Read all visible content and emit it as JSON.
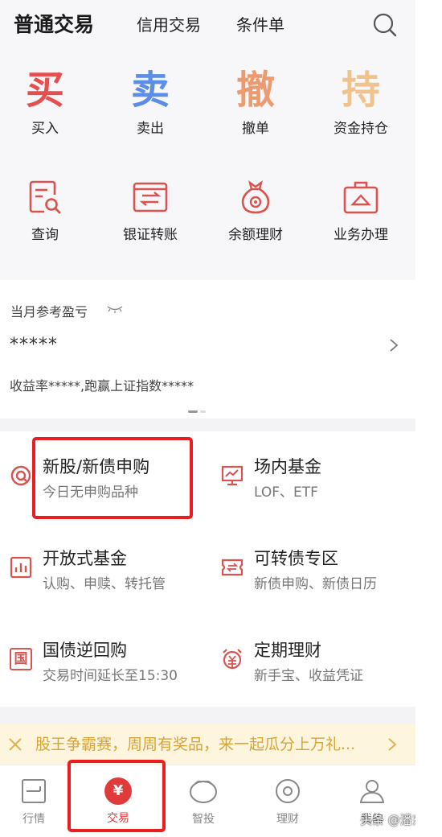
{
  "header": {
    "tabs": [
      "普通交易",
      "信用交易",
      "条件单"
    ]
  },
  "quick_actions": [
    {
      "glyph": "买",
      "label": "买入",
      "color": "#e5504f"
    },
    {
      "glyph": "卖",
      "label": "卖出",
      "color": "#5b8ee6"
    },
    {
      "glyph": "撤",
      "label": "撤单",
      "color": "#ec9b70"
    },
    {
      "glyph": "持",
      "label": "资金持仓",
      "color": "#f0c38c"
    }
  ],
  "tools": [
    {
      "icon": "query-icon",
      "label": "查询"
    },
    {
      "icon": "transfer-icon",
      "label": "银证转账"
    },
    {
      "icon": "money-bag-icon",
      "label": "余额理财"
    },
    {
      "icon": "briefcase-icon",
      "label": "业务办理"
    }
  ],
  "profit": {
    "title": "当月参考盈亏",
    "value": "*****",
    "rate": "收益率*****,跑赢上证指数*****"
  },
  "services": [
    {
      "icon": "ipo-icon",
      "title": "新股/新债申购",
      "sub": "今日无申购品种"
    },
    {
      "icon": "exchange-fund-icon",
      "title": "场内基金",
      "sub": "LOF、ETF"
    },
    {
      "icon": "open-fund-icon",
      "title": "开放式基金",
      "sub": "认购、申赎、转托管"
    },
    {
      "icon": "convertible-bond-icon",
      "title": "可转债专区",
      "sub": "新债申购、新债日历"
    },
    {
      "icon": "treasury-repo-icon",
      "glyph": "国",
      "title": "国债逆回购",
      "sub": "交易时间延长至15:30"
    },
    {
      "icon": "fixed-term-icon",
      "glyph": "¥",
      "title": "定期理财",
      "sub": "新手宝、收益凭证"
    }
  ],
  "banner": {
    "text": "股王争霸赛，周周有奖品，来一起瓜分上万礼..."
  },
  "tabbar": {
    "items": [
      {
        "label": "行情",
        "icon": "market-icon"
      },
      {
        "label": "交易",
        "icon": "trade-icon",
        "glyph": "¥"
      },
      {
        "label": "智投",
        "icon": "smart-invest-icon"
      },
      {
        "label": "理财",
        "icon": "finance-icon"
      },
      {
        "label": "我的",
        "icon": "profile-icon"
      }
    ]
  },
  "watermark": "头条 @潘东升",
  "colors": {
    "accent": "#e03a3a",
    "icon_red": "#d9534f",
    "banner_text": "#d9a437",
    "highlight_box": "#ee1c1c"
  }
}
